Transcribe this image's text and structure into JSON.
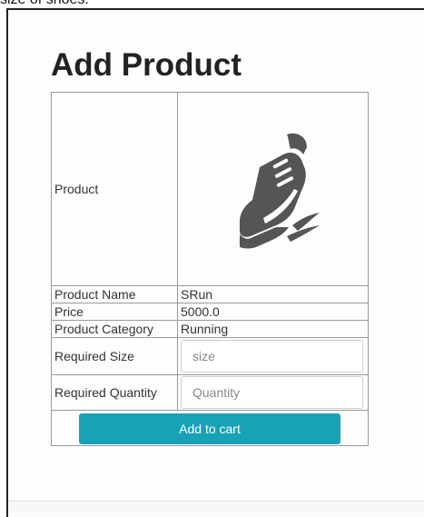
{
  "header": {
    "caption": "size of shoes."
  },
  "page": {
    "title": "Add Product"
  },
  "product": {
    "image_label": "Product",
    "image_icon": "running-shoe-icon",
    "name_label": "Product Name",
    "name_value": "SRun",
    "price_label": "Price",
    "price_value": "5000.0",
    "category_label": "Product Category",
    "category_value": "Running"
  },
  "form": {
    "size_label": "Required Size",
    "size_placeholder": "size",
    "size_value": "",
    "quantity_label": "Required Quantity",
    "quantity_placeholder": "Quantity",
    "quantity_value": ""
  },
  "actions": {
    "add_to_cart_label": "Add to cart"
  },
  "colors": {
    "button": "#17a2b8",
    "button_text": "#ffffff",
    "border": "#9a9a9a",
    "icon": "#555555"
  }
}
